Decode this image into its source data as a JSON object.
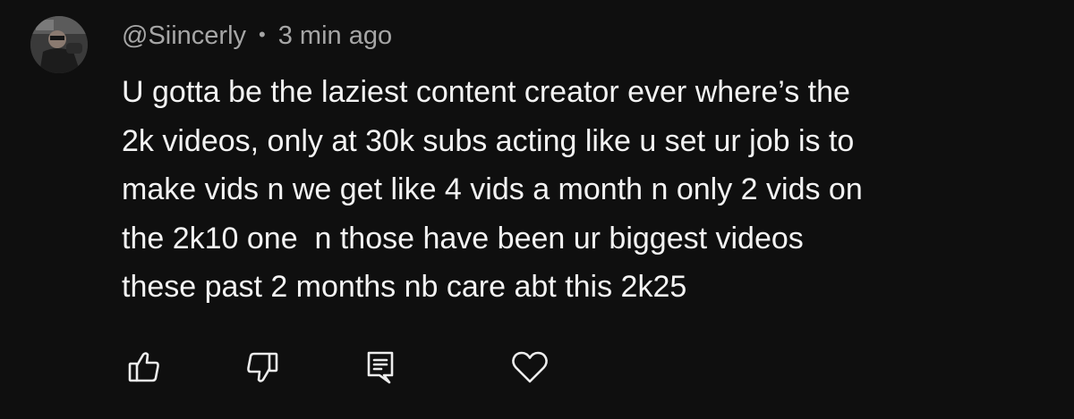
{
  "comment": {
    "username": "@Siincerly",
    "separator": "•",
    "timestamp": "3 min ago",
    "body_lines": [
      "U gotta be the laziest content creator ever where’s the",
      "2k videos, only at 30k subs acting like u set ur job is to",
      "make vids n we get like 4 vids a month n only 2 vids on",
      "the 2k10 one  n those have been ur biggest videos",
      "these past 2 months nb care abt this 2k25"
    ]
  },
  "actions": {
    "icons": [
      "thumbs-up-icon",
      "thumbs-down-icon",
      "reply-icon",
      "heart-icon"
    ]
  },
  "colors": {
    "background": "#0f0f0f",
    "text_primary": "#f3f3f3",
    "text_secondary": "#a6a6a6"
  }
}
